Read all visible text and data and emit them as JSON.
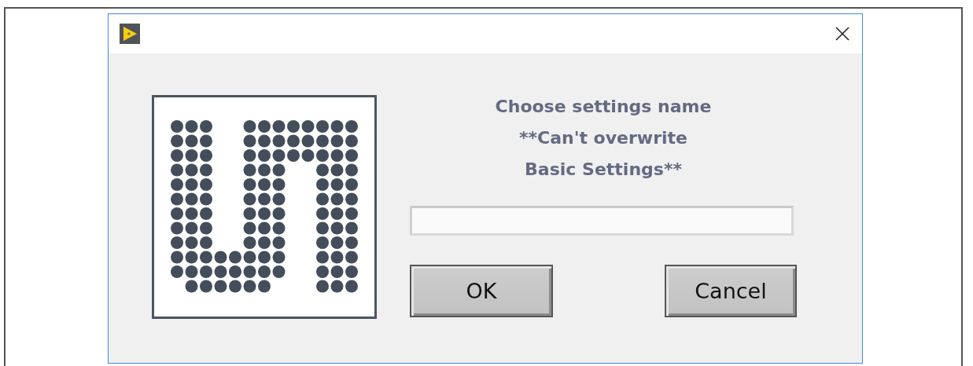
{
  "dialog": {
    "message": [
      "Choose settings name",
      "**Can't overwrite",
      "Basic Settings**"
    ],
    "buttons": [
      {
        "label": "OK",
        "kind": "ok"
      },
      {
        "label": "Cancel",
        "kind": "cancel"
      }
    ]
  }
}
